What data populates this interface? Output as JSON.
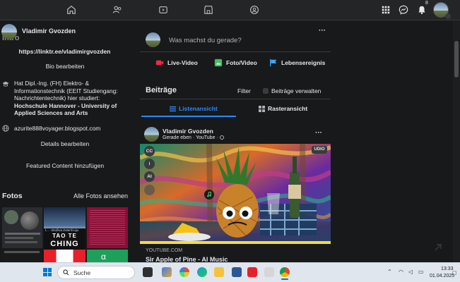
{
  "header": {
    "notification_count": "8"
  },
  "profile": {
    "name": "Vladimir Gvozden",
    "intro_title": "Intro",
    "link": "https://linktr.ee/vladimirgvozden",
    "edit_bio": "Bio bearbeiten",
    "education_prefix": "Hat Dipl.-Ing. (FH) Elektro- & Informationstechnik (EEIT Studiengang: Nachrichtentechnik) hier studiert: ",
    "education_school": "Hochschule Hannover - University of Applied Sciences and Arts",
    "website": "azurite888voyager.blogspot.com",
    "edit_details": "Details bearbeiten",
    "add_featured": "Featured Content hinzufügen",
    "photos_title": "Fotos",
    "photos_all": "Alle Fotos ansehen",
    "photo_texts": [
      "TAO TE",
      "CHING",
      "l... - Druživa Zoterili Liju"
    ]
  },
  "composer": {
    "placeholder": "Was machst du gerade?",
    "actions": [
      "Live-Video",
      "Foto/Video",
      "Lebensereignis"
    ]
  },
  "posts_section": {
    "title": "Beiträge",
    "filter": "Filter",
    "manage": "Beiträge verwalten",
    "list_view": "Listenansicht",
    "grid_view": "Rasteransicht"
  },
  "post": {
    "author": "Vladimir Gvozden",
    "meta": "Gerade eben · YouTube ·",
    "source": "YOUTUBE.COM",
    "title": "Sir Apple of Pine - AI Music",
    "side_icons": [
      "CC",
      "i",
      "AI"
    ],
    "badge": "UDIO"
  },
  "taskbar": {
    "search": "Suche",
    "time": "13:33",
    "date": "01.04.2025"
  },
  "colors": {
    "accent": "#2d88ff",
    "live": "#f02849",
    "photo": "#45bd62",
    "event": "#3ea6ff"
  }
}
